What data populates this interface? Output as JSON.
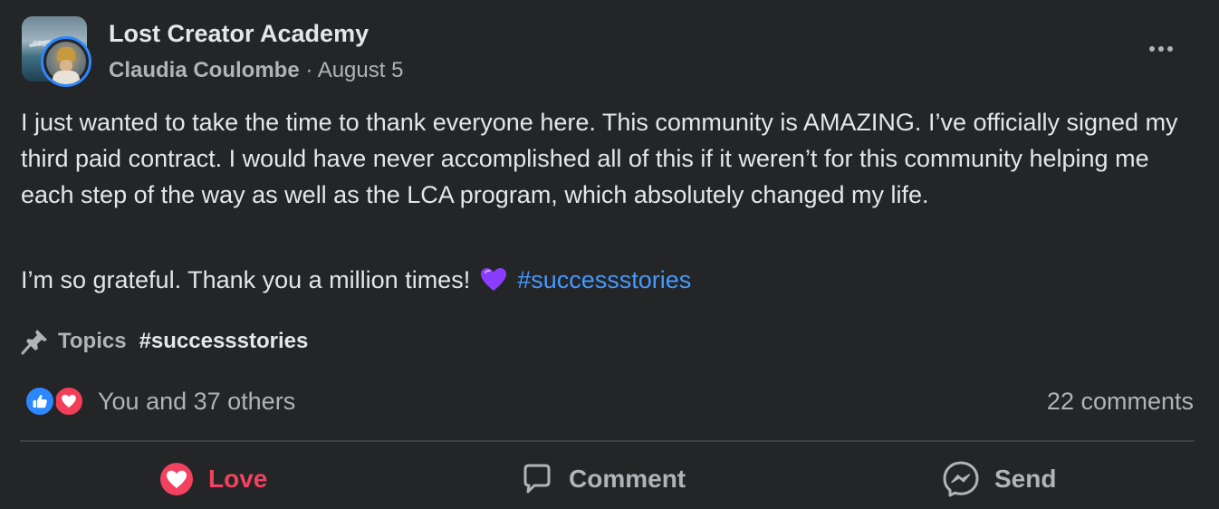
{
  "post": {
    "group_name": "Lost Creator Academy",
    "author": "Claudia Coulombe",
    "separator": "·",
    "date": "August 5",
    "avatar_text": "CRE",
    "body_paragraph": "I just wanted to take the time to thank everyone here. This community is AMAZING. I’ve officially signed my third paid contract. I would have never accomplished all of this if it weren’t for this community helping me each step of the way as well as the LCA program, which absolutely changed my life.",
    "body_line2": "I’m so grateful. Thank you a million times!",
    "body_hashtag": "#successstories",
    "emoji": "purple-heart-icon"
  },
  "topics": {
    "label": "Topics",
    "tag": "#successstories"
  },
  "reactions": {
    "summary": "You and 37 others",
    "comments": "22 comments",
    "types": [
      "like",
      "love"
    ]
  },
  "actions": {
    "love": "Love",
    "comment": "Comment",
    "send": "Send"
  },
  "colors": {
    "background": "#242526",
    "text": "#e4e6eb",
    "secondary_text": "#b0b3b8",
    "hashtag": "#4599ff",
    "love": "#f3425f",
    "like": "#2d88ff",
    "purple_heart": "#8b3dff"
  }
}
